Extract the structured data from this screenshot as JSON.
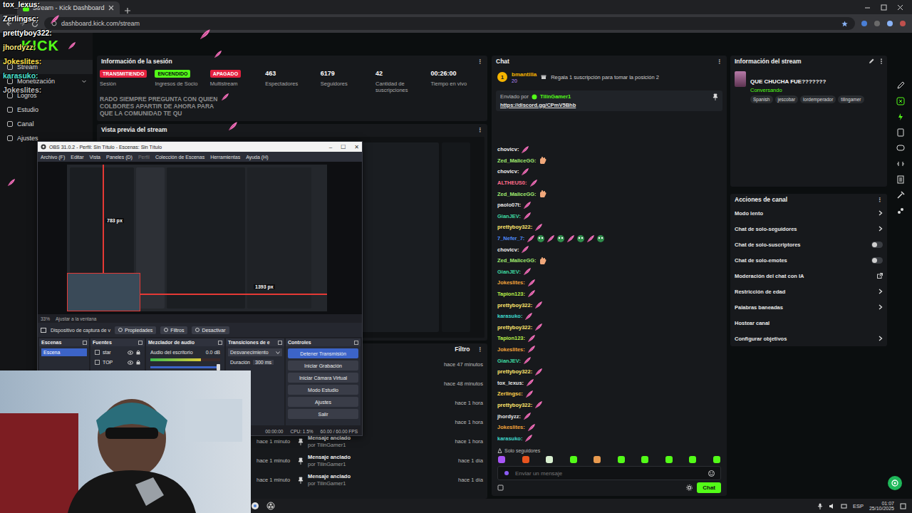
{
  "browser": {
    "tab_title": "Stream - Kick Dashboard",
    "url": "dashboard.kick.com/stream"
  },
  "overlay_chat": [
    {
      "user": "tox_lexus:",
      "color": "#ffffff"
    },
    {
      "user": "Zerlingsc:",
      "color": "#ffffff"
    },
    {
      "user": "prettyboy322:",
      "color": "#ffffff"
    },
    {
      "user": "jhordyzz:",
      "color": "#f3e27a"
    },
    {
      "user": "Jokeslites:",
      "color": "#ffe14d"
    },
    {
      "user": "karasuko:",
      "color": "#4fe0d0"
    },
    {
      "user": "Jokeslites:",
      "color": "#bdbdbd"
    }
  ],
  "overlay_message": "RADO SIEMPRE PREGUNTA CON QUIEN COLBORES APARTIR DE AHORA PARA QUE LA COMUNIDAD TE QU",
  "sidebar": {
    "logo": "KICK",
    "items": [
      {
        "label": "Stream",
        "selected": true,
        "kind": "link"
      },
      {
        "label": "Monetización",
        "selected": false,
        "kind": "group"
      },
      {
        "label": "Logros",
        "selected": false,
        "kind": "link"
      },
      {
        "label": "Estudio",
        "selected": false,
        "kind": "link"
      },
      {
        "label": "Canal",
        "selected": false,
        "kind": "link"
      },
      {
        "label": "Ajustes",
        "selected": false,
        "kind": "link"
      }
    ]
  },
  "session": {
    "title": "Información de la sesión",
    "menu": "⋮",
    "stats": [
      {
        "kind": "badge",
        "value": "TRANSMITIENDO",
        "label": "Sesión",
        "color": "#e5213f"
      },
      {
        "kind": "badge",
        "value": "ENCENDIDO",
        "label": "Ingresos de Socio",
        "color": "#53fc18"
      },
      {
        "kind": "badge",
        "value": "APAGADO",
        "label": "Multistream",
        "color": "#e5213f"
      },
      {
        "kind": "number",
        "value": "463",
        "label": "Espectadores"
      },
      {
        "kind": "number",
        "value": "6179",
        "label": "Seguidores"
      },
      {
        "kind": "number",
        "value": "42",
        "label": "Cantidad de suscripciones"
      },
      {
        "kind": "number",
        "value": "00:26:00",
        "label": "Tiempo en vivo"
      }
    ]
  },
  "preview": {
    "title": "Vista previa del stream",
    "menu": "⋮"
  },
  "obs": {
    "title": "OBS 31.0.2 - Perfil: Sin Título - Escenas: Sin Título",
    "window_buttons": [
      "–",
      "☐",
      "✕"
    ],
    "menu": [
      {
        "label": "Archivo (F)",
        "disabled": false
      },
      {
        "label": "Editar",
        "disabled": false
      },
      {
        "label": "Vista",
        "disabled": false
      },
      {
        "label": "Paneles (D)",
        "disabled": false
      },
      {
        "label": "Perfil",
        "disabled": true
      },
      {
        "label": "Colección de Escenas",
        "disabled": false
      },
      {
        "label": "Herramientas",
        "disabled": false
      },
      {
        "label": "Ayuda (H)",
        "disabled": false
      }
    ],
    "measures": [
      "783 px",
      "1393 px"
    ],
    "zoom": "33%",
    "fit": "Ajustar a la ventana",
    "source_name": "Dispositivo de captura de v",
    "source_buttons": [
      "Propiedades",
      "Filtros",
      "Desactivar"
    ],
    "scenes": {
      "title": "Escenas",
      "items": [
        {
          "label": "Escena",
          "selected": true
        }
      ]
    },
    "sources": {
      "title": "Fuentes",
      "items": [
        {
          "label": "star"
        },
        {
          "label": "TOP"
        }
      ]
    },
    "mixer": {
      "title": "Mezclador de audio",
      "channel": "Audio del escritorio",
      "reading": "0.0 dB",
      "level": 0.72,
      "volume": 1
    },
    "transitions": {
      "title": "Transiciones de e",
      "type": "Desvanecimiento",
      "duration_label": "Duración",
      "duration": "300 ms"
    },
    "controls": {
      "title": "Controles",
      "buttons": [
        {
          "label": "Detener Transmisión",
          "active": true
        },
        {
          "label": "Iniciar Grabación",
          "active": false
        },
        {
          "label": "Iniciar Cámara Virtual",
          "active": false
        },
        {
          "label": "Modo Estudio",
          "active": false
        },
        {
          "label": "Ajustes",
          "active": false
        },
        {
          "label": "Salir",
          "active": false
        }
      ]
    },
    "status": {
      "time": "00:00:00",
      "cpu": "CPU: 1.5%",
      "fps": "60.00 / 60.00 FPS"
    }
  },
  "feed": {
    "filter": "Filtro",
    "menu": "⋮",
    "rows": [
      {
        "kind": "plain",
        "left": "",
        "title": "",
        "by": "",
        "time": "hace 47 minutos"
      },
      {
        "kind": "plain",
        "left": "",
        "title": "",
        "by": "",
        "time": "hace 48 minutos"
      },
      {
        "kind": "plain",
        "left": "",
        "title": "",
        "by": "",
        "time": "hace 1 hora"
      },
      {
        "kind": "plain",
        "left": "",
        "title": "",
        "by": "",
        "time": "hace 1 hora"
      },
      {
        "kind": "pinned",
        "left": "hace 1 minuto",
        "title": "Mensaje anclado",
        "by": "por TilinGamer1",
        "time": "hace 1 hora"
      },
      {
        "kind": "pinned",
        "left": "hace 1 minuto",
        "title": "Mensaje anclado",
        "by": "por TilinGamer1",
        "time": "hace 1 día"
      },
      {
        "kind": "pinned",
        "left": "hace 1 minuto",
        "title": "Mensaje anclado",
        "by": "por TilinGamer1",
        "time": "hace 1 día"
      }
    ]
  },
  "chat": {
    "title": "Chat",
    "menu": "⋮",
    "top_gifter": {
      "rank": "1",
      "user": "bmantilla",
      "amount": "20",
      "note": "Regala 1 suscripción para tomar la posición 2"
    },
    "pinned": {
      "sent_by_label": "Enviado por",
      "sent_by": "TilinGamer1",
      "link": "https://discord.gg/CPmV5Bhb"
    },
    "messages": [
      {
        "user": "chovicv:",
        "color": "#f2f2f2",
        "kind": "feather"
      },
      {
        "user": "Zed_MaliceGG:",
        "color": "#9fe870",
        "kind": "hand"
      },
      {
        "user": "chovicv:",
        "color": "#f2f2f2",
        "kind": "feather"
      },
      {
        "user": "ALTHEUS0:",
        "color": "#ff6b8b",
        "kind": "feather"
      },
      {
        "user": "Zed_MaliceGG:",
        "color": "#9fe870",
        "kind": "hand"
      },
      {
        "user": "paolo07t:",
        "color": "#e6e6e6",
        "kind": "feather"
      },
      {
        "user": "GianJEV:",
        "color": "#3ed6a0",
        "kind": "feather"
      },
      {
        "user": "prettyboy322:",
        "color": "#ffe66d",
        "kind": "feather"
      },
      {
        "user": "7_Nefer_7:",
        "color": "#4f8dff",
        "kind": "mixed"
      },
      {
        "user": "chovicv:",
        "color": "#f2f2f2",
        "kind": "feather"
      },
      {
        "user": "Zed_MaliceGG:",
        "color": "#9fe870",
        "kind": "hand"
      },
      {
        "user": "GianJEV:",
        "color": "#3ed6a0",
        "kind": "feather"
      },
      {
        "user": "Jokeslites:",
        "color": "#f3a43b",
        "kind": "feather"
      },
      {
        "user": "Tapion123:",
        "color": "#b7f04a",
        "kind": "feather"
      },
      {
        "user": "prettyboy322:",
        "color": "#ffe66d",
        "kind": "feather"
      },
      {
        "user": "karasuko:",
        "color": "#3ed6c9",
        "kind": "feather"
      },
      {
        "user": "prettyboy322:",
        "color": "#ffe66d",
        "kind": "feather"
      },
      {
        "user": "Tapion123:",
        "color": "#b7f04a",
        "kind": "feather"
      },
      {
        "user": "Jokeslites:",
        "color": "#f3a43b",
        "kind": "feather"
      },
      {
        "user": "GianJEV:",
        "color": "#3ed6a0",
        "kind": "feather"
      },
      {
        "user": "prettyboy322:",
        "color": "#ffe66d",
        "kind": "feather"
      },
      {
        "user": "tox_lexus:",
        "color": "#e6e6e6",
        "kind": "feather"
      },
      {
        "user": "Zerlingsc:",
        "color": "#ffd24d",
        "kind": "feather"
      },
      {
        "user": "prettyboy322:",
        "color": "#ffe66d",
        "kind": "feather"
      },
      {
        "user": "jhordyzz:",
        "color": "#e6e6e6",
        "kind": "feather"
      },
      {
        "user": "Jokeslites:",
        "color": "#f3a43b",
        "kind": "feather"
      },
      {
        "user": "karasuko:",
        "color": "#3ed6c9",
        "kind": "feather"
      }
    ],
    "mode": "Solo seguidores",
    "emote_bar": [
      {
        "color": "#a855f7"
      },
      {
        "color": "#e8541f"
      },
      {
        "color": "#d9f0d0"
      },
      {
        "color": "#53fc18"
      },
      {
        "color": "#e89a4f"
      },
      {
        "color": "#53fc18"
      },
      {
        "color": "#53fc18"
      },
      {
        "color": "#53fc18"
      },
      {
        "color": "#53fc18"
      },
      {
        "color": "#53fc18"
      }
    ],
    "placeholder": "Enviar un mensaje",
    "send": "Chat"
  },
  "stream_info": {
    "title": "Información del stream",
    "stream_title": "QUE CHUCHA FUE???????",
    "category": "Conversando",
    "tags": [
      "Spanish",
      "jescobar",
      "lordemperador",
      "tilingamer"
    ]
  },
  "channel_actions": {
    "title": "Acciones de canal",
    "menu": "⋮",
    "items": [
      {
        "label": "Modo lento",
        "kind": "chevron"
      },
      {
        "label": "Chat de solo-seguidores",
        "kind": "chevron"
      },
      {
        "label": "Chat de solo-suscriptores",
        "kind": "toggle",
        "on": false
      },
      {
        "label": "Chat de solo-emotes",
        "kind": "toggle",
        "on": false
      },
      {
        "label": "Moderación del chat con IA",
        "kind": "external"
      },
      {
        "label": "Restricción de edad",
        "kind": "chevron"
      },
      {
        "label": "Palabras baneadas",
        "kind": "chevron"
      },
      {
        "label": "Hostear canal",
        "kind": "plain"
      },
      {
        "label": "Configurar objetivos",
        "kind": "chevron"
      }
    ]
  },
  "taskbar": {
    "lang": "ESP",
    "time": "01:07",
    "date": "25/10/2025"
  }
}
